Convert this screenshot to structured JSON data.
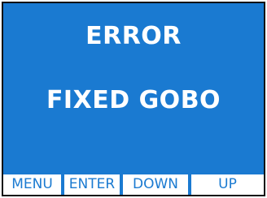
{
  "display": {
    "line1": "ERROR",
    "line2": "FIXED GOBO"
  },
  "softkeys": {
    "menu": "MENU",
    "enter": "ENTER",
    "down": "DOWN",
    "up": "UP"
  },
  "colors": {
    "screen_background": "#1a7ad1",
    "text": "#ffffff",
    "softkey_background": "#ffffff",
    "softkey_text": "#1a7ad1",
    "border": "#111111"
  }
}
